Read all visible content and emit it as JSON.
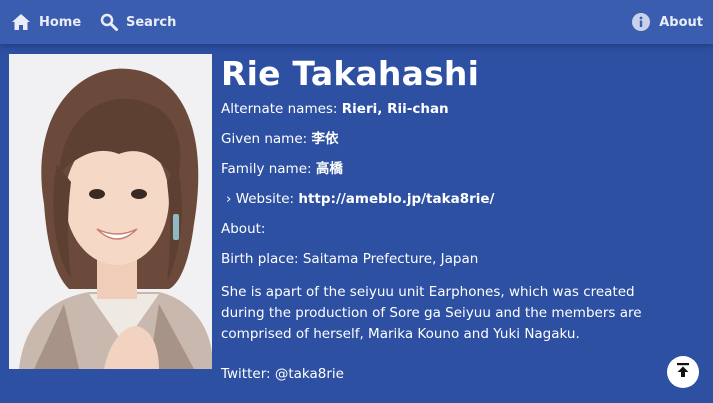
{
  "nav": {
    "home_label": "Home",
    "search_label": "Search",
    "about_label": "About"
  },
  "profile": {
    "name": "Rie Takahashi",
    "alternate_names_label": "Alternate names: ",
    "alternate_names": "Rieri, Rii-chan",
    "given_name_label": "Given name: ",
    "given_name": "李依",
    "family_name_label": "Family name: ",
    "family_name": "高橋",
    "website_label": "› Website: ",
    "website_url": "http://ameblo.jp/taka8rie/",
    "about_label": "About:",
    "birth_place": "Birth place: Saitama Prefecture, Japan",
    "description": "She is apart of the seiyuu unit Earphones, which was created during the production of Sore ga Seiyuu and the members are comprised of herself, Marika Kouno and Yuki Nagaku.",
    "twitter": "Twitter: @taka8rie"
  },
  "colors": {
    "background": "#2d50a3",
    "topbar": "#3a5daf",
    "text": "#ffffff"
  },
  "icons": {
    "home": "home-icon",
    "search": "search-icon",
    "about": "info-icon",
    "back_to_top": "arrow-up-to-line-icon"
  }
}
